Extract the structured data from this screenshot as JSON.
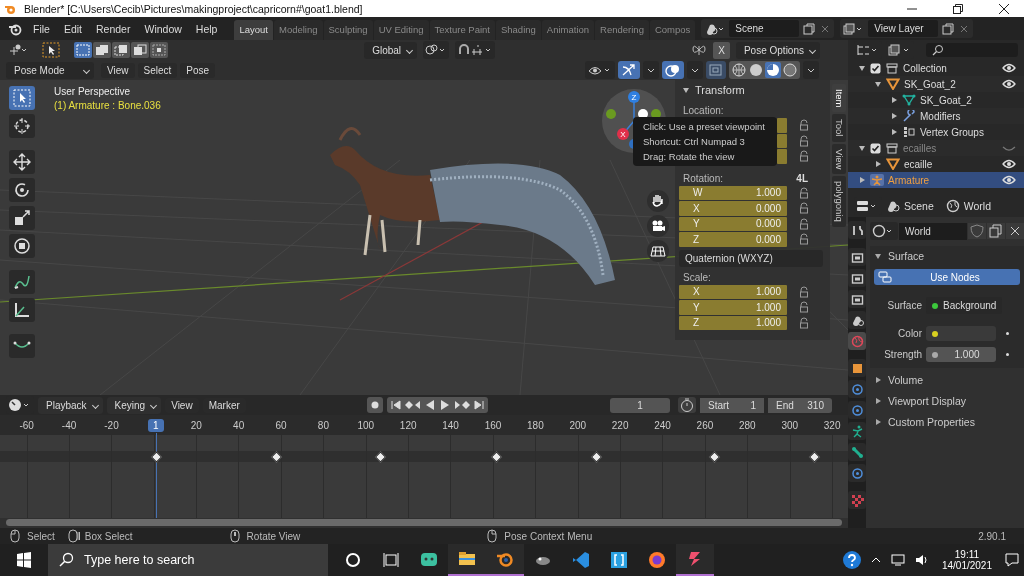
{
  "window": {
    "title": "Blender* [C:\\Users\\Cecib\\Pictures\\makingproject\\capricorn#\\goat1.blend]"
  },
  "menu": [
    "File",
    "Edit",
    "Render",
    "Window",
    "Help"
  ],
  "workspaces": [
    {
      "label": "Layout",
      "selected": true
    },
    {
      "label": "Modeling",
      "selected": false
    },
    {
      "label": "Sculpting",
      "selected": false
    },
    {
      "label": "UV Editing",
      "selected": false
    },
    {
      "label": "Texture Paint",
      "selected": false
    },
    {
      "label": "Shading",
      "selected": false
    },
    {
      "label": "Animation",
      "selected": false
    },
    {
      "label": "Rendering",
      "selected": false
    },
    {
      "label": "Compos",
      "selected": false
    }
  ],
  "scene": {
    "name": "Scene"
  },
  "view_layer": {
    "name": "View Layer"
  },
  "tool_settings": {
    "orientation": "Global",
    "mirror_x": "X",
    "pose_options": "Pose Options"
  },
  "viewport_header": {
    "mode": "Pose Mode",
    "menus": [
      "View",
      "Select",
      "Pose"
    ]
  },
  "viewport": {
    "view_name": "User Perspective",
    "context": "(1) Armature : Bone.036",
    "gizmo_axes": [
      "Z",
      "X"
    ]
  },
  "toolbar": [
    {
      "kind": "select",
      "selected": true
    },
    {
      "kind": "cursor",
      "selected": false
    },
    {
      "kind": "move",
      "selected": false
    },
    {
      "kind": "rotate",
      "selected": false
    },
    {
      "kind": "scale",
      "selected": false
    },
    {
      "kind": "transform",
      "selected": false
    },
    {
      "kind": "annotate",
      "selected": false
    },
    {
      "kind": "measure",
      "selected": false
    },
    {
      "kind": "bendy",
      "selected": false
    }
  ],
  "tooltip": {
    "lines": [
      "Click: Use a preset viewpoint",
      "Shortcut: Ctrl Numpad 3",
      "Drag: Rotate the view"
    ]
  },
  "sidebar": {
    "tabs": [
      {
        "label": "Item",
        "selected": true
      },
      {
        "label": "Tool",
        "selected": false
      },
      {
        "label": "View",
        "selected": false
      },
      {
        "label": "polygoniq",
        "selected": false
      }
    ],
    "panel": {
      "title": "Transform",
      "location_label": "Location:",
      "rotation_label": "Rotation:",
      "rotation_badge": "4L",
      "rotation": [
        {
          "axis": "W",
          "value": "1.000"
        },
        {
          "axis": "X",
          "value": "0.000"
        },
        {
          "axis": "Y",
          "value": "0.000"
        },
        {
          "axis": "Z",
          "value": "0.000"
        }
      ],
      "rotation_mode": "Quaternion (WXYZ)",
      "scale_label": "Scale:",
      "scale": [
        {
          "axis": "X",
          "value": "1.000"
        },
        {
          "axis": "Y",
          "value": "1.000"
        },
        {
          "axis": "Z",
          "value": "1.000"
        }
      ]
    }
  },
  "outliner": {
    "items": [
      {
        "label": "Collection",
        "kind": "collection",
        "checked": true,
        "eye": true,
        "expanded": true,
        "selected": false,
        "children": [
          {
            "label": "SK_Goat_2",
            "kind": "mesh",
            "eye": true,
            "expanded": true,
            "selected": false,
            "children": [
              {
                "label": "SK_Goat_2",
                "kind": "mesh_data",
                "expanded": false,
                "selected": false
              },
              {
                "label": "Modifiers",
                "kind": "modifiers",
                "expanded": false,
                "selected": false
              },
              {
                "label": "Vertex Groups",
                "kind": "vertex_groups",
                "expanded": false,
                "selected": false
              }
            ]
          }
        ]
      },
      {
        "label": "ecailles",
        "kind": "collection",
        "checked": true,
        "eye": false,
        "expanded": true,
        "selected": false,
        "children": [
          {
            "label": "ecaille",
            "kind": "mesh",
            "eye": true,
            "expanded": false,
            "selected": false
          }
        ]
      },
      {
        "label": "Armature",
        "kind": "armature",
        "eye": true,
        "expanded": false,
        "selected": true
      }
    ]
  },
  "properties": {
    "breadcrumb": [
      "Scene",
      "World"
    ],
    "tabs": [
      {
        "kind": "tool",
        "selected": false
      },
      {
        "kind": "render",
        "selected": false
      },
      {
        "kind": "output",
        "selected": false
      },
      {
        "kind": "view_layer",
        "selected": false
      },
      {
        "kind": "scene",
        "selected": false
      },
      {
        "kind": "world",
        "selected": true
      },
      {
        "kind": "object",
        "selected": false
      },
      {
        "kind": "physics",
        "selected": false
      },
      {
        "kind": "constraints",
        "selected": false
      },
      {
        "kind": "pose",
        "selected": false
      },
      {
        "kind": "bone",
        "selected": false
      },
      {
        "kind": "bone_constraints",
        "selected": false
      },
      {
        "kind": "texture",
        "selected": false
      }
    ],
    "world": "World",
    "panels": [
      {
        "title": "Surface",
        "expanded": true
      },
      {
        "title": "Volume",
        "expanded": false
      },
      {
        "title": "Viewport Display",
        "expanded": false
      },
      {
        "title": "Custom Properties",
        "expanded": false
      }
    ],
    "use_nodes": "Use Nodes",
    "surface_label": "Surface",
    "surface_value": "Background",
    "color_label": "Color",
    "strength_label": "Strength",
    "strength_value": "1.000"
  },
  "timeline": {
    "menus": [
      "Playback",
      "Keying",
      "View",
      "Marker"
    ],
    "current_frame": "1",
    "start_label": "Start",
    "start": "1",
    "end_label": "End",
    "end": "310",
    "ruler": [
      {
        "kind": "tick",
        "label": "-60"
      },
      {
        "kind": "tick",
        "label": "-40"
      },
      {
        "kind": "tick",
        "label": "-20"
      },
      {
        "kind": "playhead",
        "label": "1"
      },
      {
        "kind": "tick",
        "label": "20"
      },
      {
        "kind": "tick",
        "label": "40"
      },
      {
        "kind": "tick",
        "label": "60"
      },
      {
        "kind": "tick",
        "label": "80"
      },
      {
        "kind": "tick",
        "label": "100"
      },
      {
        "kind": "tick",
        "label": "120"
      },
      {
        "kind": "tick",
        "label": "140"
      },
      {
        "kind": "tick",
        "label": "160"
      },
      {
        "kind": "tick",
        "label": "180"
      },
      {
        "kind": "tick",
        "label": "200"
      },
      {
        "kind": "tick",
        "label": "220"
      },
      {
        "kind": "tick",
        "label": "240"
      },
      {
        "kind": "tick",
        "label": "260"
      },
      {
        "kind": "tick",
        "label": "280"
      },
      {
        "kind": "tick",
        "label": "300"
      },
      {
        "kind": "tick",
        "label": "320"
      }
    ],
    "keyframes": [
      {
        "level": 0.184
      },
      {
        "level": 0.325
      },
      {
        "level": 0.448
      },
      {
        "level": 0.585
      },
      {
        "level": 0.703
      },
      {
        "level": 0.842
      },
      {
        "level": 0.96
      }
    ]
  },
  "status_bar": {
    "items": [
      {
        "kind": "left_click",
        "label": "Select"
      },
      {
        "kind": "drag",
        "label": "Box Select"
      },
      {
        "kind": "middle_click",
        "label": "Rotate View"
      },
      {
        "kind": "right_click",
        "label": "Pose Context Menu"
      }
    ],
    "version": "2.90.1"
  },
  "taskbar": {
    "search_placeholder": "Type here to search",
    "apps": [
      {
        "kind": "cortana",
        "running": false
      },
      {
        "kind": "task_view",
        "running": false
      },
      {
        "kind": "chat",
        "running": false
      },
      {
        "kind": "files",
        "running": true
      },
      {
        "kind": "blender",
        "running": true
      },
      {
        "kind": "gimp",
        "running": false
      },
      {
        "kind": "code",
        "running": false
      },
      {
        "kind": "brackets",
        "running": false
      },
      {
        "kind": "firefox",
        "running": false
      },
      {
        "kind": "splice",
        "running": true
      }
    ],
    "time": "19:11",
    "date": "14/01/2021"
  }
}
